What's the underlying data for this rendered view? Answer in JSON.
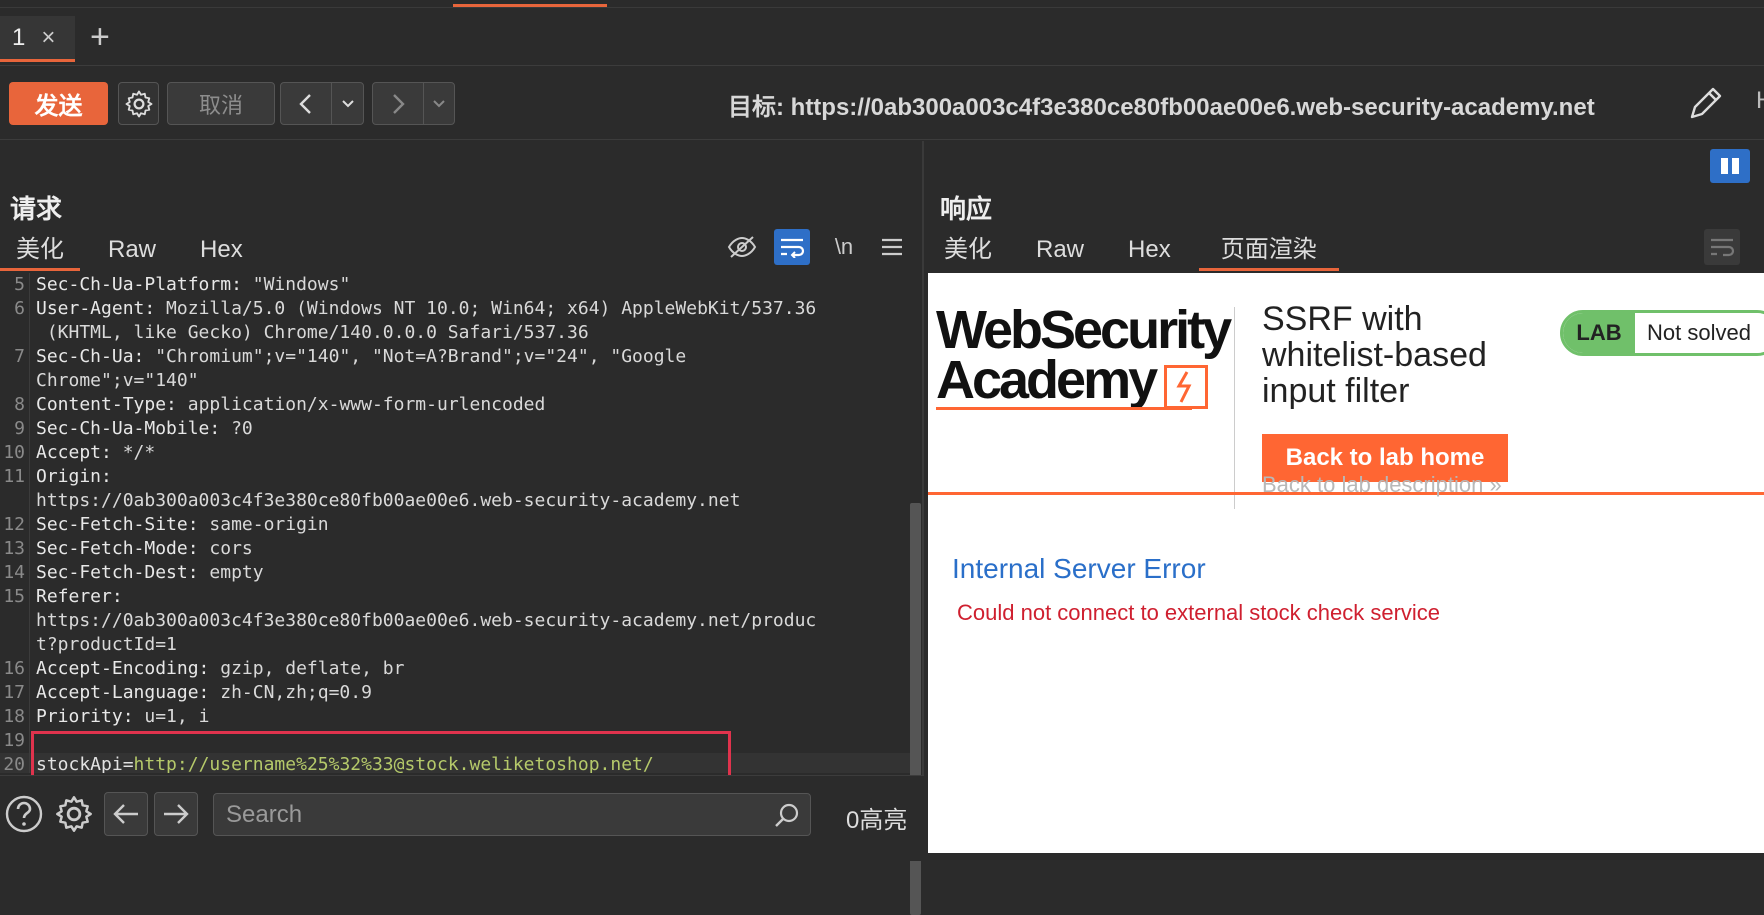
{
  "tabs": {
    "tab1_label": "1",
    "close_glyph": "×",
    "add_glyph": "+"
  },
  "toolbar": {
    "send_label": "发送",
    "cancel_label": "取消",
    "target_label": "目标: https://0ab300a003c4f3e380ce80fb00ae00e6.web-security-academy.net",
    "cut_text": "H"
  },
  "request": {
    "title": "请求",
    "tabs": [
      "美化",
      "Raw",
      "Hex"
    ],
    "newline_label": "\\n",
    "lines": [
      {
        "n": "5",
        "k": "Sec-Ch-Ua-Platform:",
        "v": " \"Windows\""
      },
      {
        "n": "6",
        "k": "User-Agent:",
        "v": " Mozilla/5.0 (Windows NT 10.0; Win64; x64) AppleWebKit/537.36"
      },
      {
        "n": "",
        "k": "",
        "v": " (KHTML, like Gecko) Chrome/140.0.0.0 Safari/537.36"
      },
      {
        "n": "7",
        "k": "Sec-Ch-Ua:",
        "v": " \"Chromium\";v=\"140\", \"Not=A?Brand\";v=\"24\", \"Google"
      },
      {
        "n": "",
        "k": "",
        "v": "Chrome\";v=\"140\""
      },
      {
        "n": "8",
        "k": "Content-Type:",
        "v": " application/x-www-form-urlencoded"
      },
      {
        "n": "9",
        "k": "Sec-Ch-Ua-Mobile:",
        "v": " ?0"
      },
      {
        "n": "10",
        "k": "Accept:",
        "v": " */*"
      },
      {
        "n": "11",
        "k": "Origin:",
        "v": ""
      },
      {
        "n": "",
        "k": "",
        "v": "https://0ab300a003c4f3e380ce80fb00ae00e6.web-security-academy.net"
      },
      {
        "n": "12",
        "k": "Sec-Fetch-Site:",
        "v": " same-origin"
      },
      {
        "n": "13",
        "k": "Sec-Fetch-Mode:",
        "v": " cors"
      },
      {
        "n": "14",
        "k": "Sec-Fetch-Dest:",
        "v": " empty"
      },
      {
        "n": "15",
        "k": "Referer:",
        "v": ""
      },
      {
        "n": "",
        "k": "",
        "v": "https://0ab300a003c4f3e380ce80fb00ae00e6.web-security-academy.net/produc"
      },
      {
        "n": "",
        "k": "",
        "v": "t?productId=1"
      },
      {
        "n": "16",
        "k": "Accept-Encoding:",
        "v": " gzip, deflate, br"
      },
      {
        "n": "17",
        "k": "Accept-Language:",
        "v": " zh-CN,zh;q=0.9"
      },
      {
        "n": "18",
        "k": "Priority:",
        "v": " u=1, i"
      },
      {
        "n": "19",
        "k": "",
        "v": ""
      }
    ],
    "body_line_no": "20",
    "body_param": "stockApi=",
    "body_value": "http://username%25%32%33@stock.weliketoshop.net/"
  },
  "search": {
    "placeholder": "Search",
    "hits": "0高亮"
  },
  "response": {
    "title": "响应",
    "tabs": [
      "美化",
      "Raw",
      "Hex",
      "页面渲染"
    ],
    "active_tab": 3
  },
  "rendered": {
    "logo_line1": "WebSecurity",
    "logo_line2": "Academy",
    "lab_title": "SSRF with whitelist-based input filter",
    "lab_badge_label": "LAB",
    "lab_status": "Not solved",
    "back_home": "Back to lab home",
    "back_desc": "Back to lab description »",
    "error_title": "Internal Server Error",
    "error_msg": "Could not connect to external stock check service"
  },
  "colors": {
    "accent": "#e8653b",
    "academy_orange": "#ff6633",
    "error_blue": "#2a6fc9",
    "error_red": "#cf1f2f",
    "highlight_box": "#e0334d"
  }
}
